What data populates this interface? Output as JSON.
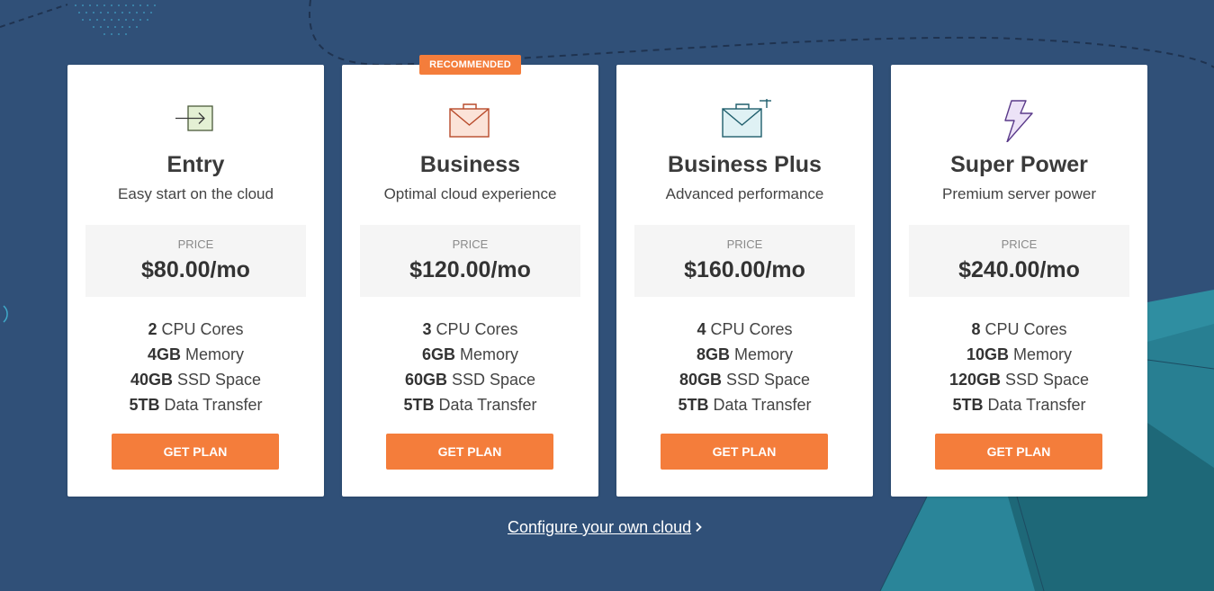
{
  "colors": {
    "background": "#305078",
    "accent": "#f47d3b",
    "card": "#ffffff",
    "price_box": "#f5f5f5",
    "teal": "#2f8ea1",
    "teal_dark": "#1e6878"
  },
  "recommended_badge": "RECOMMENDED",
  "plans": [
    {
      "icon": "arrow-into-box-icon",
      "name": "Entry",
      "description": "Easy start on the cloud",
      "price_label": "PRICE",
      "price": "$80.00/mo",
      "features": [
        {
          "value": "2",
          "label": "CPU Cores"
        },
        {
          "value": "4GB",
          "label": "Memory"
        },
        {
          "value": "40GB",
          "label": "SSD Space"
        },
        {
          "value": "5TB",
          "label": "Data Transfer"
        }
      ],
      "button": "GET PLAN"
    },
    {
      "icon": "briefcase-icon",
      "name": "Business",
      "description": "Optimal cloud experience",
      "price_label": "PRICE",
      "price": "$120.00/mo",
      "features": [
        {
          "value": "3",
          "label": "CPU Cores"
        },
        {
          "value": "6GB",
          "label": "Memory"
        },
        {
          "value": "60GB",
          "label": "SSD Space"
        },
        {
          "value": "5TB",
          "label": "Data Transfer"
        }
      ],
      "button": "GET PLAN"
    },
    {
      "icon": "briefcase-plus-icon",
      "name": "Business Plus",
      "description": "Advanced performance",
      "price_label": "PRICE",
      "price": "$160.00/mo",
      "features": [
        {
          "value": "4",
          "label": "CPU Cores"
        },
        {
          "value": "8GB",
          "label": "Memory"
        },
        {
          "value": "80GB",
          "label": "SSD Space"
        },
        {
          "value": "5TB",
          "label": "Data Transfer"
        }
      ],
      "button": "GET PLAN"
    },
    {
      "icon": "lightning-bolt-icon",
      "name": "Super Power",
      "description": "Premium server power",
      "price_label": "PRICE",
      "price": "$240.00/mo",
      "features": [
        {
          "value": "8",
          "label": "CPU Cores"
        },
        {
          "value": "10GB",
          "label": "Memory"
        },
        {
          "value": "120GB",
          "label": "SSD Space"
        },
        {
          "value": "5TB",
          "label": "Data Transfer"
        }
      ],
      "button": "GET PLAN"
    }
  ],
  "configure_link": "Configure your own cloud",
  "configure_chevron": "chevron-right-icon"
}
